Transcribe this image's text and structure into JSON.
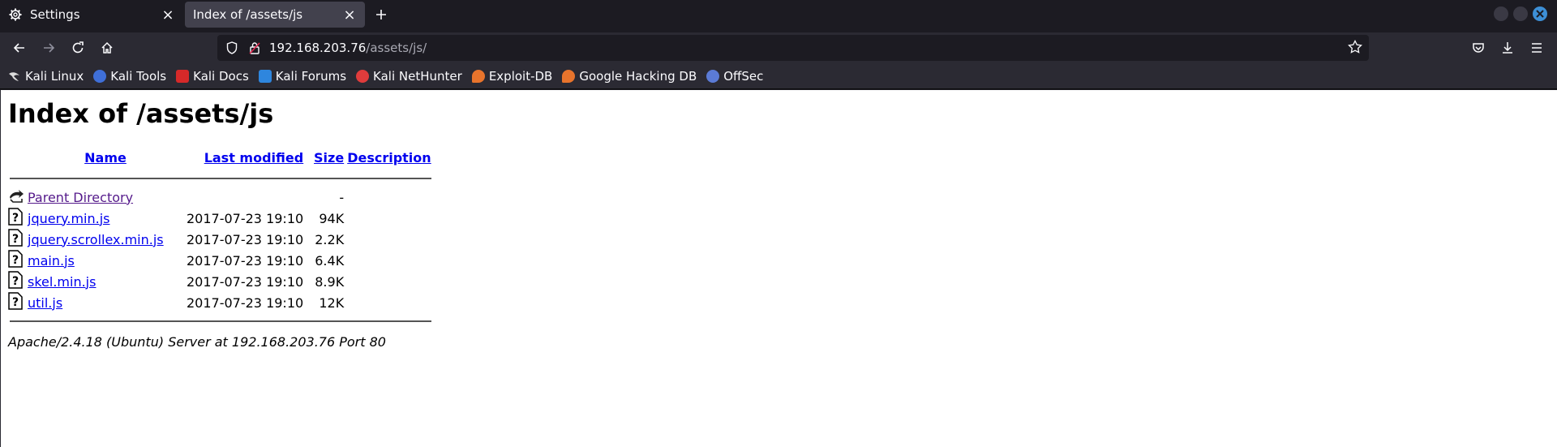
{
  "browser": {
    "tabs": [
      {
        "title": "Settings",
        "icon": "gear-icon",
        "active": false
      },
      {
        "title": "Index of /assets/js",
        "icon": "",
        "active": true
      }
    ],
    "url_host": "192.168.203.76",
    "url_path": "/assets/js/",
    "bookmarks": [
      {
        "label": "Kali Linux",
        "icon": "kali-dragon-icon",
        "color": "#367bf0"
      },
      {
        "label": "Kali Tools",
        "icon": "kali-tools-icon",
        "color": "#3f6fd8"
      },
      {
        "label": "Kali Docs",
        "icon": "kali-docs-icon",
        "color": "#d62929"
      },
      {
        "label": "Kali Forums",
        "icon": "kali-forums-icon",
        "color": "#2e86de"
      },
      {
        "label": "Kali NetHunter",
        "icon": "nethunter-icon",
        "color": "#e03c3c"
      },
      {
        "label": "Exploit-DB",
        "icon": "exploit-db-icon",
        "color": "#e8742c"
      },
      {
        "label": "Google Hacking DB",
        "icon": "ghdb-icon",
        "color": "#e8742c"
      },
      {
        "label": "OffSec",
        "icon": "offsec-icon",
        "color": "#5b7bd6"
      }
    ]
  },
  "page": {
    "heading": "Index of /assets/js",
    "columns": {
      "name": "Name",
      "modified": "Last modified",
      "size": "Size",
      "description": "Description"
    },
    "parent": {
      "name": "Parent Directory",
      "size": "-"
    },
    "files": [
      {
        "name": "jquery.min.js",
        "modified": "2017-07-23 19:10",
        "size": "94K"
      },
      {
        "name": "jquery.scrollex.min.js",
        "modified": "2017-07-23 19:10",
        "size": "2.2K"
      },
      {
        "name": "main.js",
        "modified": "2017-07-23 19:10",
        "size": "6.4K"
      },
      {
        "name": "skel.min.js",
        "modified": "2017-07-23 19:10",
        "size": "8.9K"
      },
      {
        "name": "util.js",
        "modified": "2017-07-23 19:10",
        "size": "12K"
      }
    ],
    "footer": "Apache/2.4.18 (Ubuntu) Server at 192.168.203.76 Port 80"
  }
}
